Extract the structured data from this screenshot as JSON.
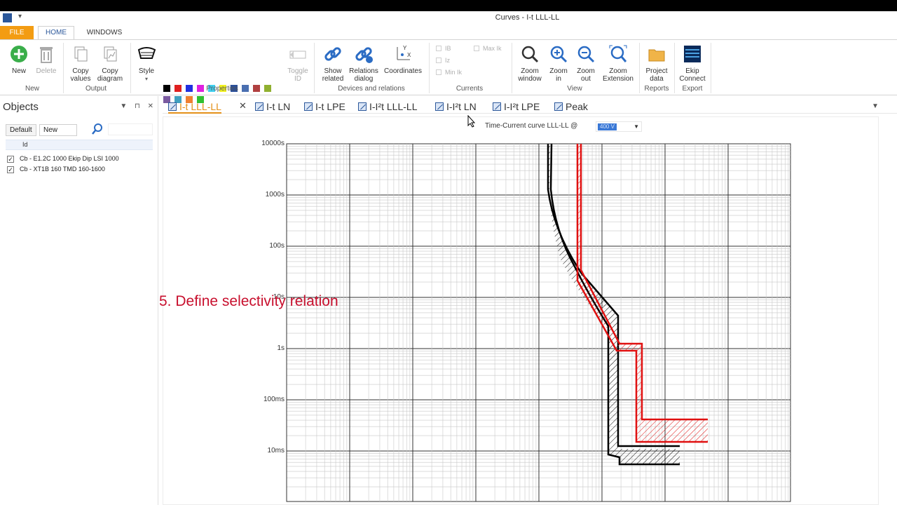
{
  "window": {
    "title": "Curves - I-t LLL-LL"
  },
  "menu": {
    "file": "FILE",
    "home": "HOME",
    "windows": "WINDOWS"
  },
  "ribbon": {
    "new": "New",
    "delete": "Delete",
    "copy_values": "Copy values",
    "copy_diagram": "Copy diagram",
    "style": "Style",
    "toggle_id": "Toggle ID",
    "show_related": "Show related",
    "relations_dialog": "Relations dialog",
    "coordinates": "Coordinates",
    "zoom_window": "Zoom window",
    "zoom_in": "Zoom in",
    "zoom_out": "Zoom out",
    "zoom_extension": "Zoom Extension",
    "project_data": "Project data",
    "ekip_connect": "Ekip Connect",
    "chk_ib": "IB",
    "chk_iz": "Iz",
    "chk_min_ik": "Min Ik",
    "chk_max_ik": "Max Ik",
    "groups": {
      "new": "New",
      "output": "Output",
      "properties": "Properties",
      "devices": "Devices and relations",
      "currents": "Currents",
      "view": "View",
      "reports": "Reports",
      "export": "Export"
    },
    "swatch_colors": [
      "#000000",
      "#e02020",
      "#2030e0",
      "#e020e0",
      "#40d0f0",
      "#f0f020",
      "#2a4f9a",
      "#4a6fb0",
      "#b04040",
      "#90b030",
      "#7a5aa0",
      "#40a0c0",
      "#f08030",
      "#30c030"
    ]
  },
  "objects_panel": {
    "title": "Objects",
    "filter_default": "Default",
    "filter_new": "New",
    "column_id": "Id",
    "items": [
      {
        "label": "Cb - E1.2C 1000 Ekip Dip LSI 1000",
        "checked": "✓"
      },
      {
        "label": "Cb - XT1B 160 TMD 160-1600",
        "checked": "✓"
      }
    ]
  },
  "doc_tabs": [
    "I-t LLL-LL",
    "I-t LN",
    "I-t LPE",
    "I-I²t LLL-LL",
    "I-I²t LN",
    "I-I²t LPE",
    "Peak"
  ],
  "chart_header": {
    "title": "Time-Current curve LLL-LL @",
    "voltage": "400 V"
  },
  "chart_data": {
    "type": "line",
    "xscale": "log",
    "yscale": "log",
    "y_tick_labels": [
      "10000s",
      "1000s",
      "100s",
      "10s",
      "1s",
      "100ms",
      "10ms"
    ],
    "grid": true,
    "series": [
      {
        "color": "#000000"
      },
      {
        "color": "#e01010"
      }
    ]
  },
  "annotation": "5. Define selectivity relation"
}
